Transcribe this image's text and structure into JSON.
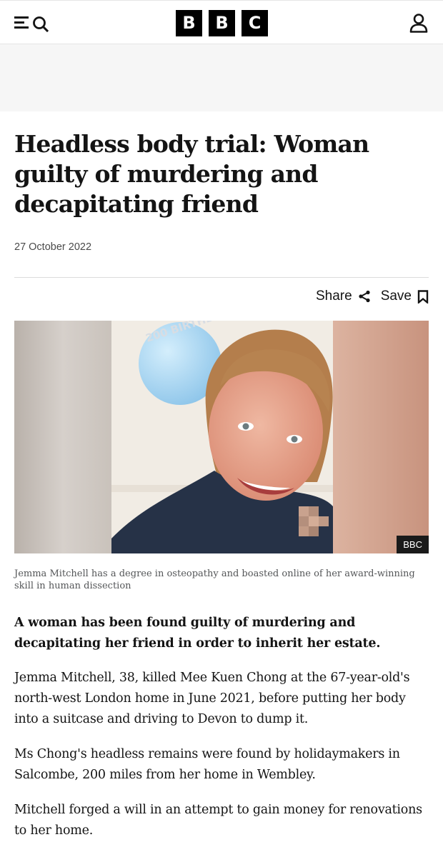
{
  "header": {
    "logo_letters": [
      "B",
      "B",
      "C"
    ],
    "icons": {
      "menu": "menu-icon",
      "search": "search-icon",
      "account": "account-icon"
    }
  },
  "article": {
    "headline": "Headless body trial: Woman guilty of murdering and decapitating friend",
    "date": "27 October 2022",
    "actions": {
      "share_label": "Share",
      "save_label": "Save"
    },
    "image": {
      "balloon_text": "200 BIRTHDAY",
      "credit": "BBC",
      "caption": "Jemma Mitchell has a degree in osteopathy and boasted online of her award-winning skill in human dissection"
    },
    "lede": "A woman has been found guilty of murdering and decapitating her friend in order to inherit her estate.",
    "paragraphs": [
      "Jemma Mitchell, 38, killed Mee Kuen Chong at the 67-year-old's north-west London home in June 2021, before putting her body into a suitcase and driving to Devon to dump it.",
      "Ms Chong's headless remains were found by holidaymakers in Salcombe, 200 miles from her home in Wembley.",
      "Mitchell forged a will in an attempt to gain money for renovations to her home."
    ]
  },
  "colors": {
    "text": "#141414",
    "secondary_text": "#545658",
    "logo_bg": "#000000",
    "ad_bg": "#f6f6f6"
  }
}
